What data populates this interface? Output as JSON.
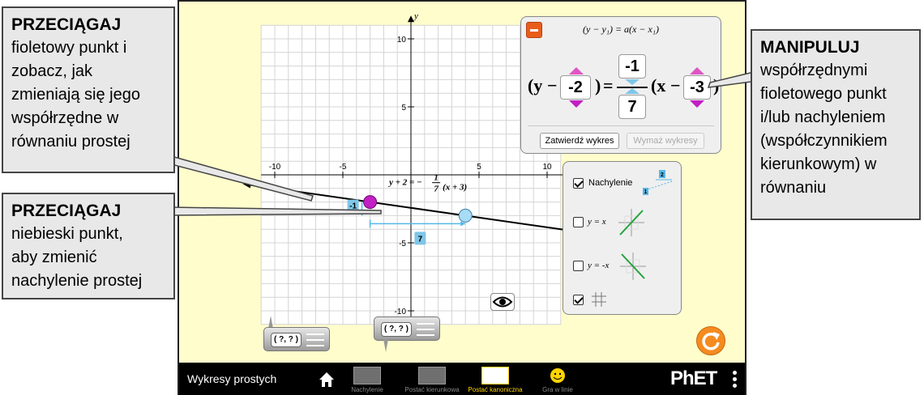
{
  "annotations": {
    "purple": {
      "title": "PRZECIĄGAJ",
      "lines": [
        "fioletowy punkt i",
        "zobacz, jak",
        "zmieniają się jego",
        "współrzędne w",
        "równaniu prostej"
      ]
    },
    "blue": {
      "title": "PRZECIĄGAJ",
      "lines": [
        "niebieski punkt,",
        "aby zmienić",
        "nachylenie prostej"
      ]
    },
    "manip": {
      "title": "MANIPULUJ",
      "lines": [
        "współrzędnymi",
        "fioletowego punkt",
        "i/lub nachyleniem",
        "(współczynnikiem",
        "kierunkowym) w",
        "równaniu"
      ]
    }
  },
  "graph": {
    "x_axis_label": "x",
    "y_axis_label": "y",
    "x_ticks": [
      "-10",
      "-5",
      "5",
      "10"
    ],
    "y_ticks": [
      "10",
      "5",
      "-5",
      "-10"
    ],
    "line_label": {
      "lhs": "y + 2 = −",
      "num": "1",
      "den": "7",
      "rhs": "(x + 3)"
    },
    "rise_label": "-1",
    "run_label": "7"
  },
  "equation_panel": {
    "template": "(y − y₁) = a(x − x₁)",
    "y_open": "(y −",
    "y1": "-2",
    "y_close": ")",
    "equals": "=",
    "slope_num": "-1",
    "slope_den": "7",
    "x_open": "(x −",
    "x1": "-3",
    "x_close": ")",
    "save_button": "Zatwierdź wykres",
    "erase_button": "Wymaż wykresy"
  },
  "graph_options": {
    "slope": {
      "label": "Nachylenie",
      "checked": true,
      "rise": "2",
      "run": "1"
    },
    "y_eq_x": {
      "label": "y = x",
      "checked": false
    },
    "y_eq_neg_x": {
      "label": "y = -x",
      "checked": false
    },
    "grid": {
      "checked": true
    }
  },
  "point_tools": [
    {
      "readout": "( ?, ? )"
    },
    {
      "readout": "( ?, ? )"
    }
  ],
  "navbar": {
    "title": "Wykresy prostych",
    "screens": [
      {
        "label": "Nachylenie",
        "active": false
      },
      {
        "label": "Postać kierunkowa",
        "active": false
      },
      {
        "label": "Postać kanoniczna",
        "active": true
      },
      {
        "label": "Gra w linie",
        "active": false
      }
    ],
    "logo": "PhET"
  },
  "colors": {
    "sim_bg": "#fffdcc",
    "purple_point": "#c21fc4",
    "blue_point": "#7fc6e8",
    "slope_tool": "#55b7e6",
    "reset": "#f58b1f",
    "accent_orange": "#e85d1a",
    "active_tab": "#ffd400"
  }
}
